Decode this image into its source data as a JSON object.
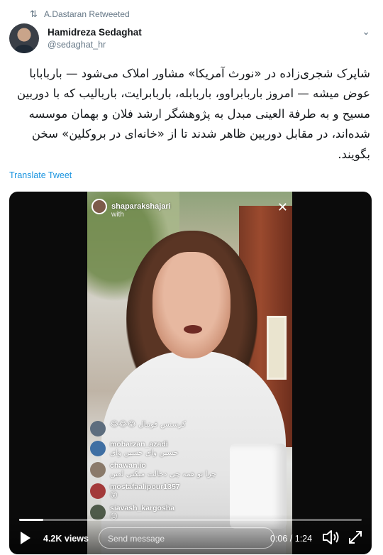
{
  "retweet": {
    "text": "A.Dastaran Retweeted",
    "icon": "retweet-icon"
  },
  "author": {
    "name": "Hamidreza Sedaghat",
    "handle": "@sedaghat_hr"
  },
  "tweet": {
    "text": "شاپرک شجری‌زاده در «نورث آمریکا» مشاور املاک می‌شود — باربابابا عوض میشه — امروز باربابراوو، باربابله، باربابرایت، باربالیب که با دوربین مسیح و به طرفة العینی مبدل به پژوهشگر ارشد فلان و بهمان موسسه شده‌اند، در مقابل دوربین ظاهر شدند تا از «خانه‌ای در بروکلین» سخن بگویند."
  },
  "translate_label": "Translate Tweet",
  "video": {
    "live_user": "shaparakshajari",
    "live_sub": "with",
    "comments": [
      {
        "user": "",
        "message": "😂😂😂 کرسنس فوتبال"
      },
      {
        "user": "mobarzan_azadi",
        "message": "حسین وای حسین وای"
      },
      {
        "user": "chawan.io",
        "message": "چرا تو همه چی دخالت میکنی لعین"
      },
      {
        "user": "mostafaalipour1357",
        "message": "😮"
      },
      {
        "user": "siavash_kargosha",
        "message": "😊"
      }
    ],
    "views": "4.2K views",
    "send_placeholder": "Send message",
    "time": "0:06 / 1:24",
    "progress_fraction": 0.07
  },
  "colors": {
    "link": "#1b95e0",
    "muted": "#657786",
    "text": "#14171a"
  }
}
